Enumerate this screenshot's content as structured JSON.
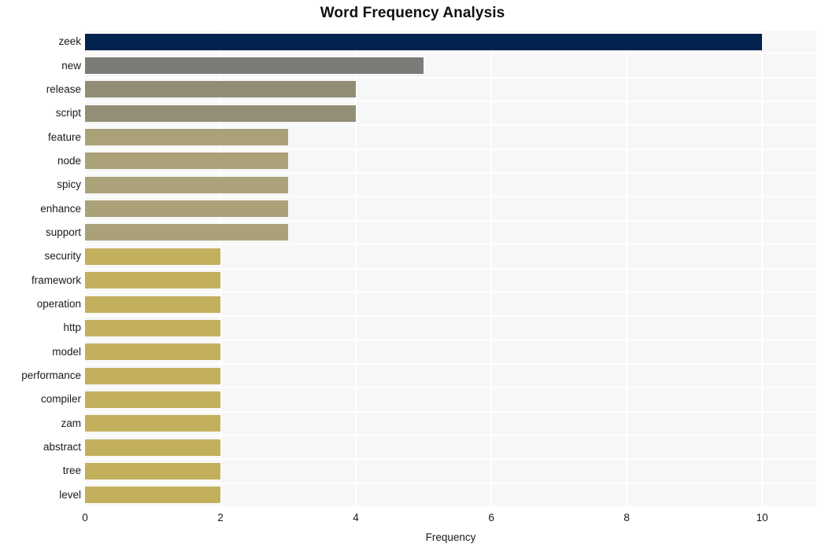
{
  "chart_data": {
    "type": "bar",
    "orientation": "horizontal",
    "title": "Word Frequency Analysis",
    "xlabel": "Frequency",
    "ylabel": "",
    "categories": [
      "zeek",
      "new",
      "release",
      "script",
      "feature",
      "node",
      "spicy",
      "enhance",
      "support",
      "security",
      "framework",
      "operation",
      "http",
      "model",
      "performance",
      "compiler",
      "zam",
      "abstract",
      "tree",
      "level"
    ],
    "values": [
      10,
      5,
      4,
      4,
      3,
      3,
      3,
      3,
      3,
      2,
      2,
      2,
      2,
      2,
      2,
      2,
      2,
      2,
      2,
      2
    ],
    "xlim": [
      0,
      10.8
    ],
    "xticks": [
      0,
      2,
      4,
      6,
      8,
      10
    ],
    "xtick_labels": [
      "0",
      "2",
      "4",
      "6",
      "8",
      "10"
    ],
    "grid": true,
    "grid_color": "#ffffff",
    "plot_background": "#f7f7f7",
    "legend": null,
    "bar_colors": [
      "#042250",
      "#7b7b77",
      "#918e75",
      "#938f77",
      "#aba179",
      "#aca27a",
      "#aca27a",
      "#aba179",
      "#aba179",
      "#c2b05c",
      "#c2b05c",
      "#c2b05c",
      "#c2b05c",
      "#c2b05c",
      "#c2b05c",
      "#c2b05c",
      "#c2b05c",
      "#c2b05c",
      "#c2b05c",
      "#c2b05c"
    ]
  }
}
